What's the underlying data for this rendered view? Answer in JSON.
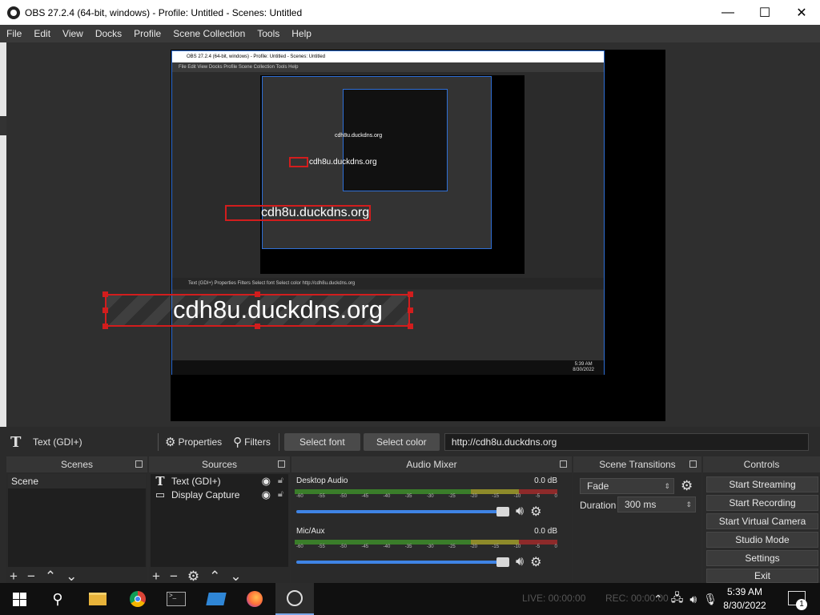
{
  "window": {
    "title": "OBS 27.2.4 (64-bit, windows) - Profile: Untitled - Scenes: Untitled",
    "minimize": "—",
    "maximize": "☐",
    "close": "✕"
  },
  "menu": [
    "File",
    "Edit",
    "View",
    "Docks",
    "Profile",
    "Scene Collection",
    "Tools",
    "Help"
  ],
  "preview": {
    "overlay_text": "cdh8u.duckdns.org",
    "nested_window_title": "OBS 27.2.4 (64-bit, windows) - Profile: Untitled - Scenes: Untitled",
    "nested_menu": "File   Edit   View   Docks   Profile   Scene Collection   Tools   Help",
    "nested_props": "Text (GDI+)         Properties    Filters       Select font       Select color      http://cdh8u.duckdns.org",
    "nested_clock_time": "5:39 AM",
    "nested_clock_date": "8/30/2022"
  },
  "properties_bar": {
    "source_name": "Text (GDI+)",
    "properties_label": "Properties",
    "filters_label": "Filters",
    "select_font_label": "Select font",
    "select_color_label": "Select color",
    "url_value": "http://cdh8u.duckdns.org"
  },
  "docks": {
    "scenes": {
      "title": "Scenes",
      "items": [
        "Scene"
      ],
      "toolbar": [
        "+",
        "−",
        "⌃",
        "⌄"
      ]
    },
    "sources": {
      "title": "Sources",
      "items": [
        {
          "label": "Text (GDI+)",
          "icon": "text-icon"
        },
        {
          "label": "Display Capture",
          "icon": "monitor-icon"
        }
      ],
      "toolbar": [
        "+",
        "−",
        "⚙",
        "⌃",
        "⌄"
      ]
    },
    "audio_mixer": {
      "title": "Audio Mixer",
      "channels": [
        {
          "name": "Desktop Audio",
          "level": "0.0 dB"
        },
        {
          "name": "Mic/Aux",
          "level": "0.0 dB"
        }
      ],
      "ticks": [
        "-60",
        "-55",
        "-50",
        "-45",
        "-40",
        "-35",
        "-30",
        "-25",
        "-20",
        "-15",
        "-10",
        "-5",
        "0"
      ]
    },
    "scene_transitions": {
      "title": "Scene Transitions",
      "transition": "Fade",
      "duration_label": "Duration",
      "duration_value": "300 ms"
    },
    "controls": {
      "title": "Controls",
      "buttons": [
        "Start Streaming",
        "Start Recording",
        "Start Virtual Camera",
        "Studio Mode",
        "Settings",
        "Exit"
      ]
    }
  },
  "status": {
    "live": "LIVE: 00:00:00",
    "rec": "REC: 00:00:00"
  },
  "taskbar": {
    "time": "5:39 AM",
    "date": "8/30/2022",
    "notification_count": "1"
  },
  "colors": {
    "selection": "#d21d1d",
    "accent_blue": "#3f84e5"
  }
}
